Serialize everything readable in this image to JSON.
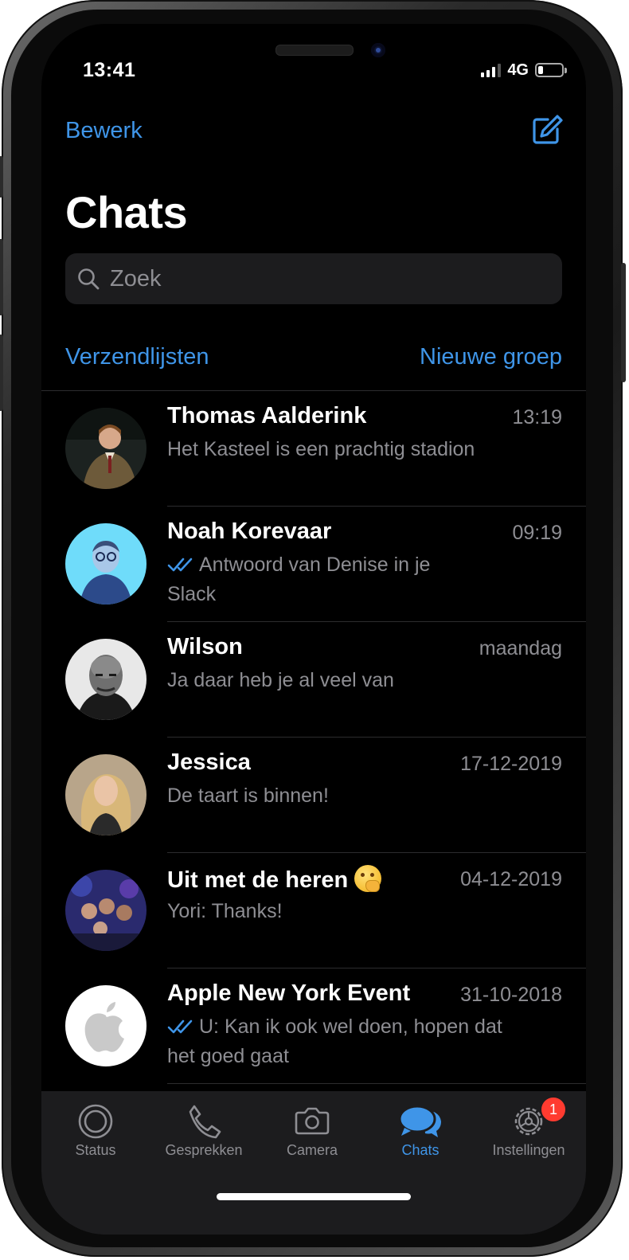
{
  "status_bar": {
    "time": "13:41",
    "network": "4G"
  },
  "header": {
    "edit_label": "Bewerk",
    "title": "Chats",
    "search_placeholder": "Zoek",
    "broadcast_label": "Verzendlijsten",
    "new_group_label": "Nieuwe groep"
  },
  "chats": [
    {
      "name": "Thomas Aalderink",
      "time": "13:19",
      "message": "Het Kasteel is een prachtig stadion",
      "read_ticks": false
    },
    {
      "name": "Noah Korevaar",
      "time": "09:19",
      "message": "Antwoord van Denise in je Slack",
      "read_ticks": true
    },
    {
      "name": "Wilson",
      "time": "maandag",
      "message": "Ja daar heb je al veel van",
      "read_ticks": false
    },
    {
      "name": "Jessica",
      "time": "17-12-2019",
      "message": "De taart is binnen!",
      "read_ticks": false
    },
    {
      "name": "Uit met de heren",
      "time": "04-12-2019",
      "message": "Yori: Thanks!",
      "read_ticks": false,
      "emoji": "shushing-face"
    },
    {
      "name": "Apple New York Event",
      "time": "31-10-2018",
      "message": "U: Kan ik ook wel doen, hopen dat het goed gaat",
      "read_ticks": true
    }
  ],
  "tabs": [
    {
      "label": "Status",
      "icon": "status-ring-icon"
    },
    {
      "label": "Gesprekken",
      "icon": "phone-icon"
    },
    {
      "label": "Camera",
      "icon": "camera-icon"
    },
    {
      "label": "Chats",
      "icon": "chat-bubbles-icon",
      "active": true
    },
    {
      "label": "Instellingen",
      "icon": "gear-icon",
      "badge": "1"
    }
  ],
  "colors": {
    "accent": "#3f95e8",
    "background": "#000000",
    "secondary_text": "#8e8e93",
    "badge": "#ff3b30"
  }
}
